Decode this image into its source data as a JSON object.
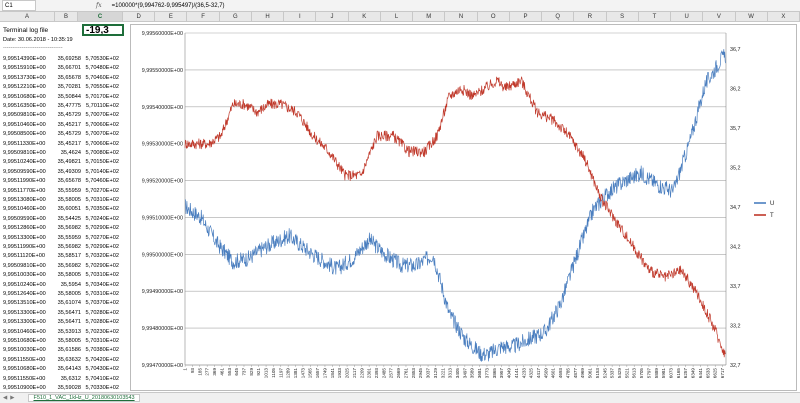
{
  "toolbar": {
    "cell_ref": "C1",
    "fx_label": "fx",
    "formula": "=100000*(9,994762-9,995497)/(36,5-32,7)"
  },
  "columns": [
    "A",
    "B",
    "C",
    "D",
    "E",
    "F",
    "G",
    "H",
    "I",
    "J",
    "K",
    "L",
    "M",
    "N",
    "O",
    "P",
    "Q",
    "R",
    "S",
    "T",
    "U",
    "V",
    "W",
    "X"
  ],
  "selected_column": "C",
  "sheet": {
    "title": "Terminal log file",
    "c1_value": "-19,3",
    "date": "Date: 30.06.2018 - 10:35:19",
    "separator": "--------------------------------",
    "rows": [
      [
        "9,99514390E+00",
        "35,69258",
        "5,70530E+02"
      ],
      [
        "9,99515910E+00",
        "35,66701",
        "5,70480E+02"
      ],
      [
        "9,99513730E+00",
        "35,65678",
        "5,70460E+02"
      ],
      [
        "9,99512210E+00",
        "35,70281",
        "5,70550E+02"
      ],
      [
        "9,99510680E+00",
        "35,50844",
        "5,70170E+02"
      ],
      [
        "9,99516350E+00",
        "35,47775",
        "5,70110E+02"
      ],
      [
        "9,99509810E+00",
        "35,45729",
        "5,70070E+02"
      ],
      [
        "9,99510460E+00",
        "35,45217",
        "5,70060E+02"
      ],
      [
        "9,99508500E+00",
        "35,45729",
        "5,70070E+02"
      ],
      [
        "9,99511330E+00",
        "35,45217",
        "5,70060E+02"
      ],
      [
        "9,99509810E+00",
        "35,4624",
        "5,70080E+02"
      ],
      [
        "9,99510240E+00",
        "35,49821",
        "5,70150E+02"
      ],
      [
        "9,99509590E+00",
        "35,49309",
        "5,70140E+02"
      ],
      [
        "9,99511990E+00",
        "35,65678",
        "5,70460E+02"
      ],
      [
        "9,99511770E+00",
        "35,55959",
        "5,70270E+02"
      ],
      [
        "9,99513080E+00",
        "35,58005",
        "5,70310E+02"
      ],
      [
        "9,99510460E+00",
        "35,60051",
        "5,70350E+02"
      ],
      [
        "9,99509590E+00",
        "35,54425",
        "5,70240E+02"
      ],
      [
        "9,99512860E+00",
        "35,56982",
        "5,70290E+02"
      ],
      [
        "9,99513300E+00",
        "35,55959",
        "5,70270E+02"
      ],
      [
        "9,99511990E+00",
        "35,56982",
        "5,70290E+02"
      ],
      [
        "9,99511120E+00",
        "35,58517",
        "5,70320E+02"
      ],
      [
        "9,99509810E+00",
        "35,56982",
        "5,70290E+02"
      ],
      [
        "9,99510030E+00",
        "35,58005",
        "5,70310E+02"
      ],
      [
        "9,99510240E+00",
        "35,5954",
        "5,70340E+02"
      ],
      [
        "9,99512640E+00",
        "35,58005",
        "5,70310E+02"
      ],
      [
        "9,99513510E+00",
        "35,61074",
        "5,70370E+02"
      ],
      [
        "9,99513300E+00",
        "35,56471",
        "5,70280E+02"
      ],
      [
        "9,99513300E+00",
        "35,56471",
        "5,70280E+02"
      ],
      [
        "9,99510460E+00",
        "35,53913",
        "5,70230E+02"
      ],
      [
        "9,99510680E+00",
        "35,58005",
        "5,70310E+02"
      ],
      [
        "9,99510030E+00",
        "35,61586",
        "5,70380E+02"
      ],
      [
        "9,99511550E+00",
        "35,63632",
        "5,70420E+02"
      ],
      [
        "9,99510680E+00",
        "35,64143",
        "5,70430E+02"
      ],
      [
        "9,99511550E+00",
        "35,6312",
        "5,70410E+02"
      ],
      [
        "9,99510900E+00",
        "35,59028",
        "5,70330E+02"
      ]
    ]
  },
  "chart_data": {
    "type": "line",
    "y_left": {
      "ticks": [
        "9,99560000E+00",
        "9,99550000E+00",
        "9,99540000E+00",
        "9,99530000E+00",
        "9,99520000E+00",
        "9,99510000E+00",
        "9,99500000E+00",
        "9,99490000E+00",
        "9,99480000E+00",
        "9,99470000E+00"
      ],
      "min": 9.9947,
      "max": 9.9956
    },
    "y_right": {
      "ticks": [
        "36,7",
        "36,2",
        "35,7",
        "35,2",
        "34,7",
        "34,2",
        "33,7",
        "33,2",
        "32,7"
      ],
      "min": 32.7,
      "max": 36.9
    },
    "x_ticks": [
      "1",
      "93",
      "185",
      "277",
      "369",
      "461",
      "553",
      "645",
      "737",
      "829",
      "921",
      "1013",
      "1105",
      "1197",
      "1289",
      "1381",
      "1473",
      "1565",
      "1657",
      "1749",
      "1841",
      "1933",
      "2025",
      "2117",
      "2209",
      "2301",
      "2393",
      "2485",
      "2577",
      "2669",
      "2761",
      "2853",
      "2945",
      "3037",
      "3129",
      "3221",
      "3313",
      "3405",
      "3497",
      "3589",
      "3681",
      "3773",
      "3865",
      "3957",
      "4049",
      "4141",
      "4233",
      "4325",
      "4417",
      "4509",
      "4601",
      "4693",
      "4785",
      "4877",
      "4969",
      "5061",
      "5153",
      "5245",
      "5337",
      "5429",
      "5521",
      "5613",
      "5705",
      "5797",
      "5889",
      "5981",
      "6073",
      "6165",
      "6257",
      "6349",
      "6441",
      "6533",
      "6625",
      "6717"
    ],
    "series": [
      {
        "name": "U",
        "axis": "left",
        "color": "#4a7ebf",
        "x": [
          0,
          200,
          400,
          600,
          800,
          1000,
          1300,
          1600,
          1900,
          2100,
          2300,
          2500,
          2700,
          2900,
          3100,
          3300,
          3500,
          3700,
          3800,
          3950,
          4100,
          4300,
          4500,
          4700,
          4900,
          5100,
          5300,
          5500,
          5700,
          5900,
          6100,
          6300,
          6500,
          6700,
          6760
        ],
        "y": [
          9.99513,
          9.9951,
          9.99503,
          9.99498,
          9.99499,
          9.99502,
          9.99505,
          9.995,
          9.99496,
          9.99499,
          9.99504,
          9.995,
          9.99497,
          9.99497,
          9.995,
          9.99484,
          9.99477,
          9.99473,
          9.99473,
          9.99475,
          9.99475,
          9.99477,
          9.99479,
          9.99487,
          9.995,
          9.99512,
          9.99517,
          9.9952,
          9.99522,
          9.99519,
          9.99517,
          9.9953,
          9.99546,
          9.99553,
          9.99554
        ]
      },
      {
        "name": "T",
        "axis": "right",
        "color": "#c0392b",
        "x": [
          0,
          150,
          300,
          450,
          600,
          750,
          900,
          1050,
          1200,
          1400,
          1600,
          1800,
          2000,
          2200,
          2400,
          2600,
          2800,
          3000,
          3150,
          3300,
          3450,
          3600,
          3750,
          3900,
          4000,
          4200,
          4400,
          4600,
          4800,
          5000,
          5200,
          5400,
          5600,
          5800,
          6000,
          6200,
          6400,
          6600,
          6760
        ],
        "y": [
          35.5,
          35.5,
          35.5,
          35.6,
          36.0,
          36.0,
          35.9,
          36.0,
          36.0,
          35.9,
          35.6,
          35.4,
          35.1,
          35.1,
          35.6,
          35.6,
          35.4,
          35.4,
          35.6,
          36.1,
          36.2,
          36.1,
          36.2,
          36.3,
          36.2,
          36.3,
          35.9,
          35.8,
          35.6,
          35.3,
          34.8,
          34.5,
          34.2,
          33.9,
          33.8,
          33.9,
          33.6,
          33.2,
          32.8
        ]
      }
    ],
    "legend": {
      "position": "right",
      "entries": [
        "U",
        "T"
      ]
    },
    "grid": true
  },
  "bottom": {
    "sheet_tab": "F510_1_VAC_1kHz_U_20180630103543"
  }
}
